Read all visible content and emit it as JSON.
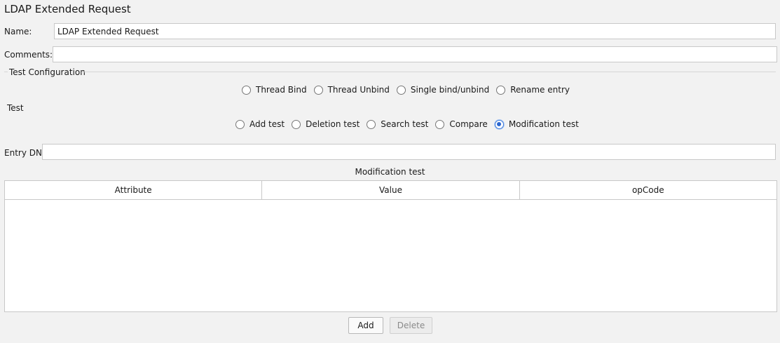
{
  "title": "LDAP Extended Request",
  "name": {
    "label": "Name:",
    "value": "LDAP Extended Request"
  },
  "comments": {
    "label": "Comments:",
    "value": ""
  },
  "test_configuration": {
    "legend": "Test Configuration",
    "bind_options": [
      "Thread Bind",
      "Thread Unbind",
      "Single bind/unbind",
      "Rename entry"
    ],
    "test_label": "Test",
    "test_options": [
      "Add test",
      "Deletion test",
      "Search test",
      "Compare",
      "Modification test"
    ],
    "selected": "Modification test"
  },
  "entry_dn": {
    "label": "Entry DN",
    "value": ""
  },
  "modification": {
    "title": "Modification test",
    "columns": [
      "Attribute",
      "Value",
      "opCode"
    ],
    "rows": []
  },
  "buttons": {
    "add": "Add",
    "delete": "Delete"
  },
  "colors": {
    "selected_radio": "#2a66d0",
    "background": "#f2f2f2"
  }
}
